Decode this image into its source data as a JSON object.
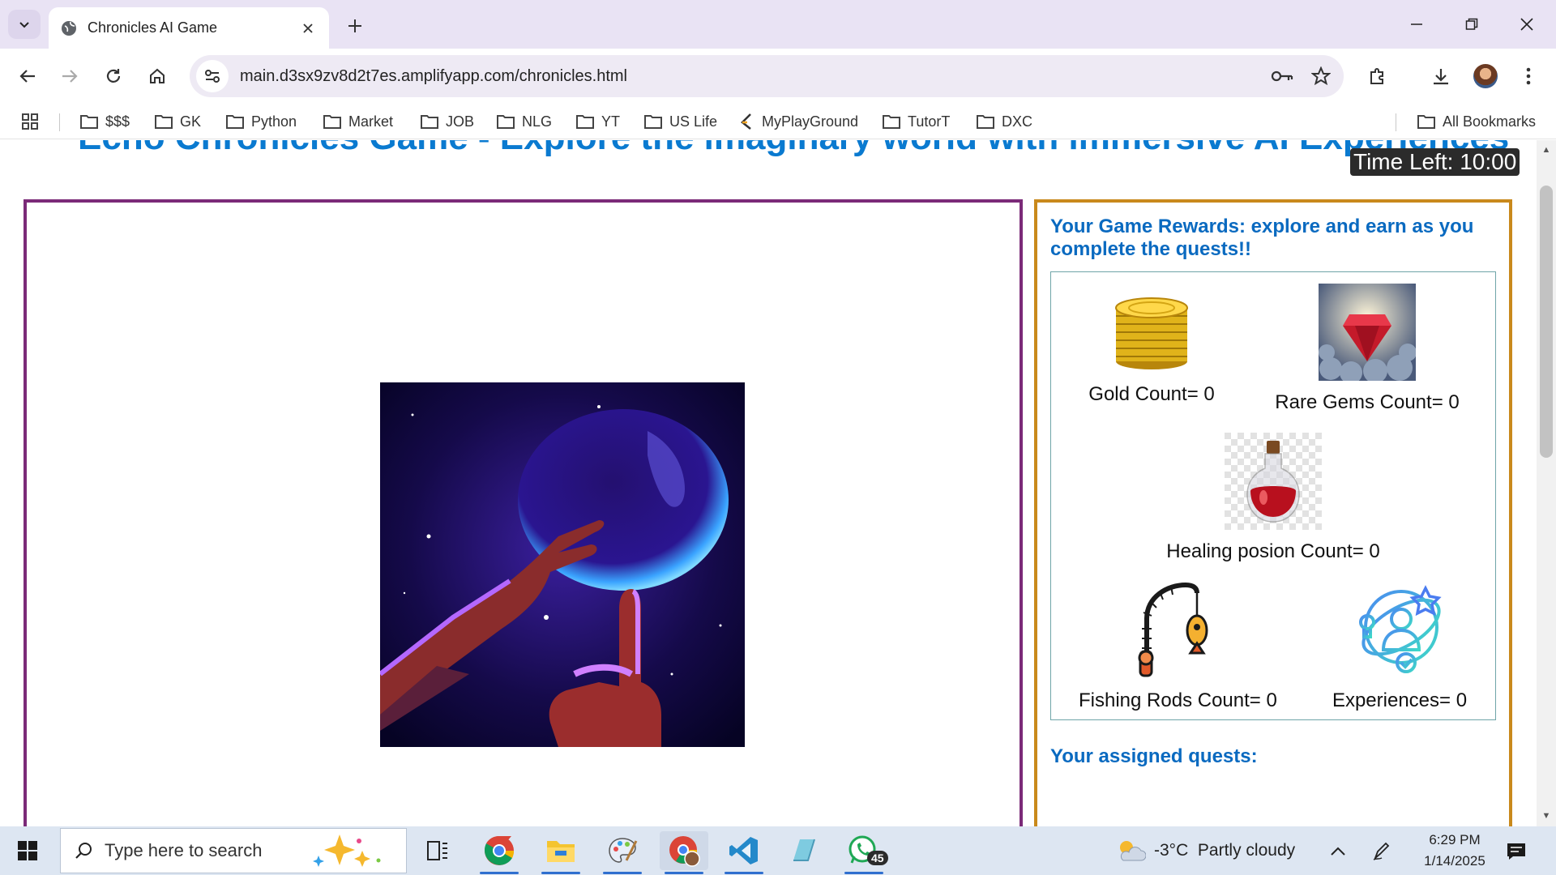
{
  "browser": {
    "tab_title": "Chronicles AI Game",
    "url": "main.d3sx9zv8d2t7es.amplifyapp.com/chronicles.html",
    "bookmarks": [
      "$$$",
      "GK",
      "Python",
      "Market",
      "JOB",
      "NLG",
      "YT",
      "US Life",
      "MyPlayGround",
      "TutorT",
      "DXC"
    ],
    "all_bookmarks_label": "All Bookmarks"
  },
  "page": {
    "heading": "Echo Chronicles Game - Explore the imaginary world with immersive AI Experiences",
    "timer": "Time Left: 10:00",
    "rewards_title": "Your Game Rewards: explore and earn as you complete the quests!!",
    "rewards": {
      "gold": "Gold Count= 0",
      "gems": "Rare Gems Count= 0",
      "potion": "Healing posion Count= 0",
      "rods": "Fishing Rods Count= 0",
      "experiences": "Experiences= 0"
    },
    "quests_title": "Your assigned quests:"
  },
  "taskbar": {
    "search_placeholder": "Type here to search",
    "whatsapp_badge": "45",
    "weather": "-3°C  Partly cloudy",
    "time": "6:29 PM",
    "date": "1/14/2025"
  },
  "colors": {
    "heading": "#0a7ad0",
    "stage_border": "#7b2a78",
    "rewards_border": "#c9891c",
    "rewards_title": "#0a6ac0"
  }
}
